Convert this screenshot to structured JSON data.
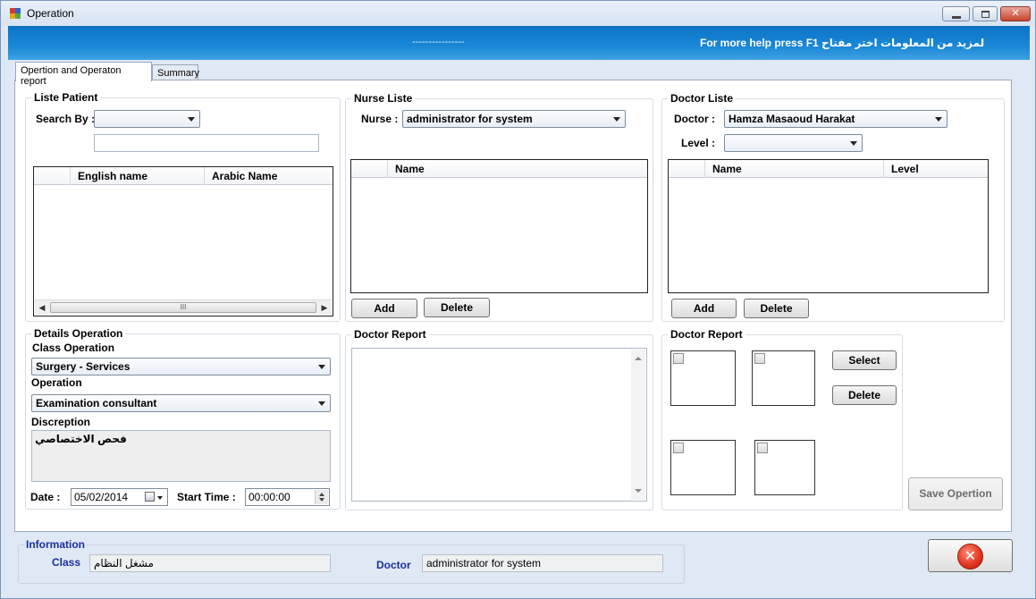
{
  "window": {
    "title": "Operation"
  },
  "banner": {
    "dashes": "----------------",
    "help_text": "For more help press F1 لمزيد من المعلومات اختر مفتاح"
  },
  "tabs": [
    {
      "label": "Opertion and Operaton report",
      "active": true
    },
    {
      "label": "Summary",
      "active": false
    }
  ],
  "patient": {
    "title": "Liste Patient",
    "search_by_label": "Search By :",
    "search_by_value": "",
    "search_text": "",
    "columns": [
      "English name",
      "Arabic Name"
    ],
    "rows": []
  },
  "nurse": {
    "title": "Nurse Liste",
    "nurse_label": "Nurse :",
    "nurse_value": "administrator for system",
    "columns": [
      "Name"
    ],
    "rows": [],
    "add_label": "Add",
    "delete_label": "Delete"
  },
  "doctor": {
    "title": "Doctor Liste",
    "doctor_label": "Doctor :",
    "doctor_value": "Hamza Masaoud Harakat",
    "level_label": "Level :",
    "level_value": "",
    "columns": [
      "Name",
      "Level"
    ],
    "rows": [],
    "add_label": "Add",
    "delete_label": "Delete"
  },
  "details": {
    "title": "Details Operation",
    "class_label": "Class  Operation",
    "class_value": "Surgery - Services",
    "operation_label": "Operation",
    "operation_value": "Examination consultant",
    "description_label": "Discreption",
    "description_value": "فحص الاختصاصي",
    "date_label": "Date :",
    "date_value": "05/02/2014",
    "start_time_label": "Start Time :",
    "start_time_value": "00:00:00"
  },
  "doctor_report_text": {
    "title": "Doctor Report",
    "value": ""
  },
  "doctor_report_images": {
    "title": "Doctor Report",
    "select_label": "Select",
    "delete_label": "Delete",
    "save_label": "Save Opertion"
  },
  "information": {
    "title": "Information",
    "class_label": "Class",
    "class_value": "مشغل النظام",
    "doctor_label": "Doctor",
    "doctor_value": "administrator for system"
  },
  "colors": {
    "banner": "#1a87d6",
    "info_label": "#1a2f9c",
    "exit_button": "#e0321b"
  },
  "icons": {
    "app": "app-icon",
    "minimize": "minimize-icon",
    "maximize": "maximize-icon",
    "close": "close-icon",
    "exit": "exit-x-icon"
  }
}
